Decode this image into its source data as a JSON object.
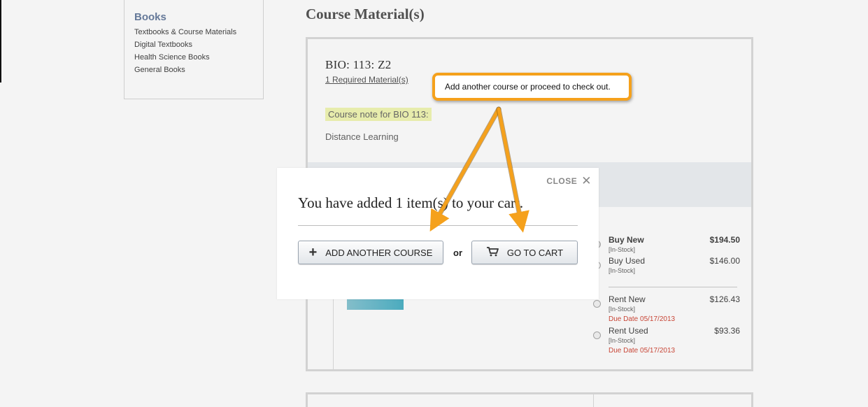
{
  "sidebar": {
    "title": "Books",
    "links": [
      "Textbooks & Course Materials",
      "Digital Textbooks",
      "Health Science Books",
      "General Books"
    ]
  },
  "main": {
    "title": "Course Material(s)",
    "course_code": "BIO:  113:  Z2",
    "required_link": "1 Required Material(s)",
    "course_note": "Course note for  BIO  113:",
    "distance": "Distance Learning"
  },
  "options": [
    {
      "label": "Buy New",
      "stock": "[In-Stock]",
      "price": "$194.50",
      "due": "",
      "selected": true
    },
    {
      "label": "Buy Used",
      "stock": "[In-Stock]",
      "price": "$146.00",
      "due": "",
      "selected": false
    },
    {
      "label": "Rent New",
      "stock": "[In-Stock]",
      "price": "$126.43",
      "due": "Due Date 05/17/2013",
      "selected": false
    },
    {
      "label": "Rent Used",
      "stock": "[In-Stock]",
      "price": "$93.36",
      "due": "Due Date 05/17/2013",
      "selected": false
    }
  ],
  "modal": {
    "close_label": "CLOSE",
    "message": "You have added 1 item(s) to your cart.",
    "add_course_label": "ADD ANOTHER COURSE",
    "or_label": "or",
    "go_to_cart_label": "GO TO CART"
  },
  "tooltip": {
    "text": "Add another course or proceed to check out."
  },
  "colors": {
    "accent": "#f5a11c",
    "due_date": "#d24a3a",
    "note_highlight": "#f2f7b4",
    "nav_title": "#6a7fa0"
  },
  "icons": {
    "close": "close-icon",
    "add": "plus-icon",
    "cart": "cart-icon"
  }
}
